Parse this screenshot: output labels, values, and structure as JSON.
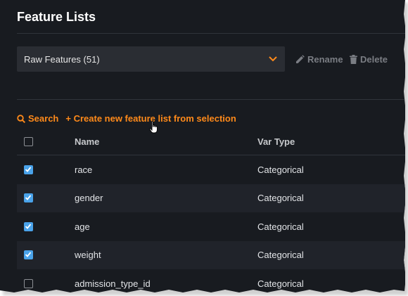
{
  "page": {
    "title": "Feature Lists"
  },
  "feature_list_select": {
    "selected": "Raw Features (51)"
  },
  "actions": {
    "rename": "Rename",
    "delete": "Delete"
  },
  "toolbar": {
    "search": "Search",
    "create": "+ Create new feature list from selection"
  },
  "table": {
    "columns": [
      "Name",
      "Var Type"
    ],
    "rows": [
      {
        "name": "race",
        "type": "Categorical",
        "checked": true
      },
      {
        "name": "gender",
        "type": "Categorical",
        "checked": true
      },
      {
        "name": "age",
        "type": "Categorical",
        "checked": true
      },
      {
        "name": "weight",
        "type": "Categorical",
        "checked": true
      },
      {
        "name": "admission_type_id",
        "type": "Categorical",
        "checked": false
      }
    ]
  },
  "colors": {
    "accent": "#ff8a1a",
    "checkbox": "#4aa3ea",
    "background": "#181b20"
  }
}
